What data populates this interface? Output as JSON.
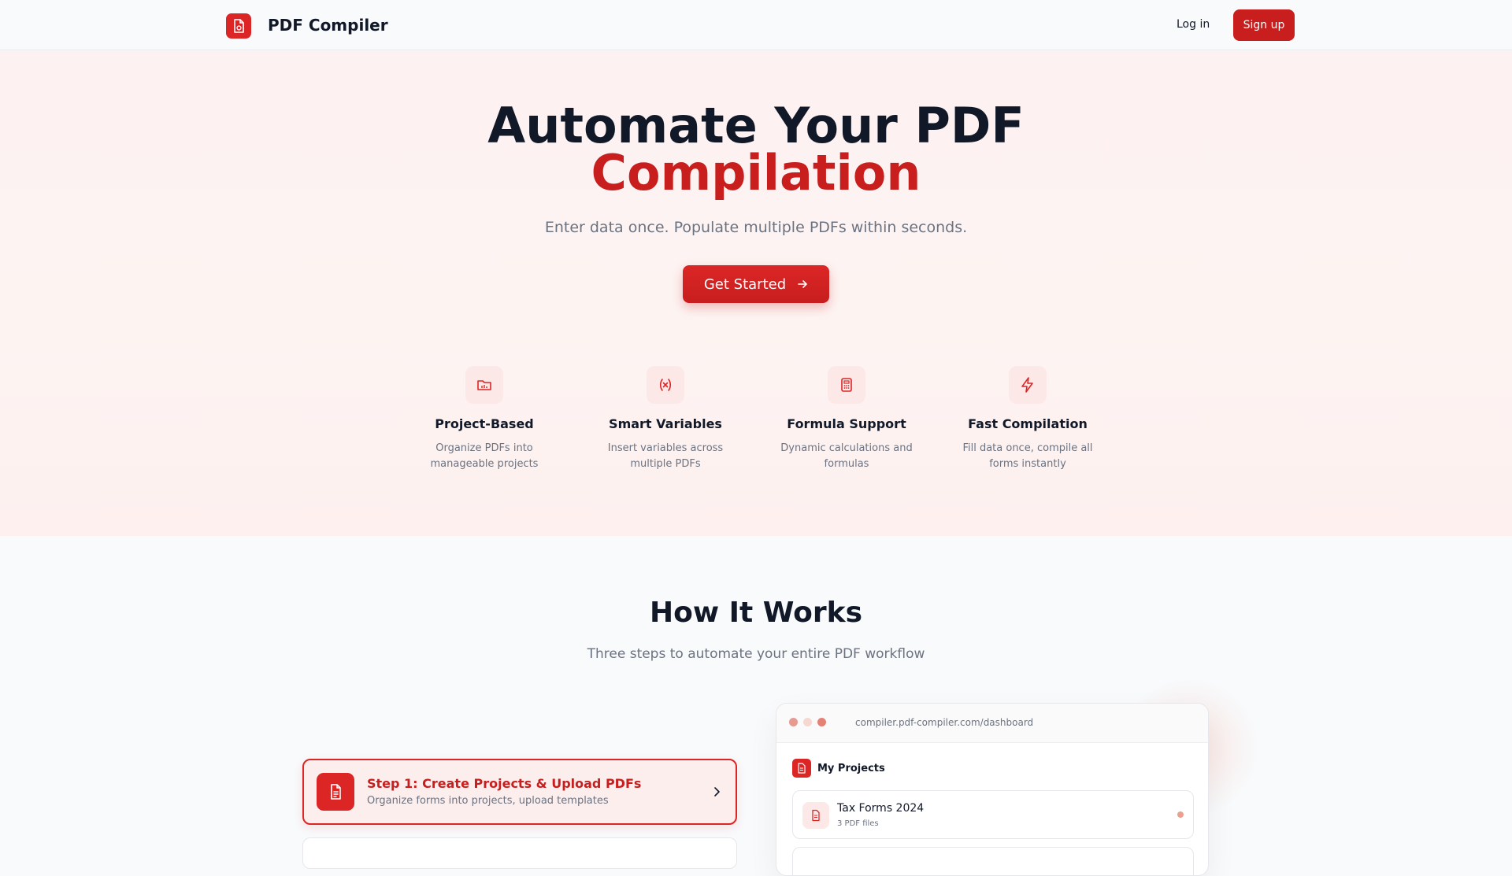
{
  "nav": {
    "brand": "PDF Compiler",
    "login": "Log in",
    "signup": "Sign up"
  },
  "hero": {
    "title_line1": "Automate Your PDF",
    "title_line2": "Compilation",
    "subtitle": "Enter data once. Populate multiple PDFs within seconds.",
    "cta_label": "Get Started"
  },
  "features": [
    {
      "title": "Project-Based",
      "desc": "Organize PDFs into manageable projects",
      "icon": "folder-icon"
    },
    {
      "title": "Smart Variables",
      "desc": "Insert variables across multiple PDFs",
      "icon": "variable-icon"
    },
    {
      "title": "Formula Support",
      "desc": "Dynamic calculations and formulas",
      "icon": "calculator-icon"
    },
    {
      "title": "Fast Compilation",
      "desc": "Fill data once, compile all forms instantly",
      "icon": "lightning-icon"
    }
  ],
  "how": {
    "title": "How It Works",
    "subtitle": "Three steps to automate your entire PDF workflow"
  },
  "steps": [
    {
      "title": "Step 1: Create Projects & Upload PDFs",
      "desc": "Organize forms into projects, upload templates"
    }
  ],
  "preview": {
    "url": "compiler.pdf-compiler.com/dashboard",
    "heading": "My Projects",
    "projects": [
      {
        "name": "Tax Forms 2024",
        "meta": "3 PDF files"
      }
    ]
  },
  "colors": {
    "accent": "#dc2626",
    "accent_dark": "#c81e1e",
    "text": "#111827",
    "muted": "#6b7280"
  }
}
